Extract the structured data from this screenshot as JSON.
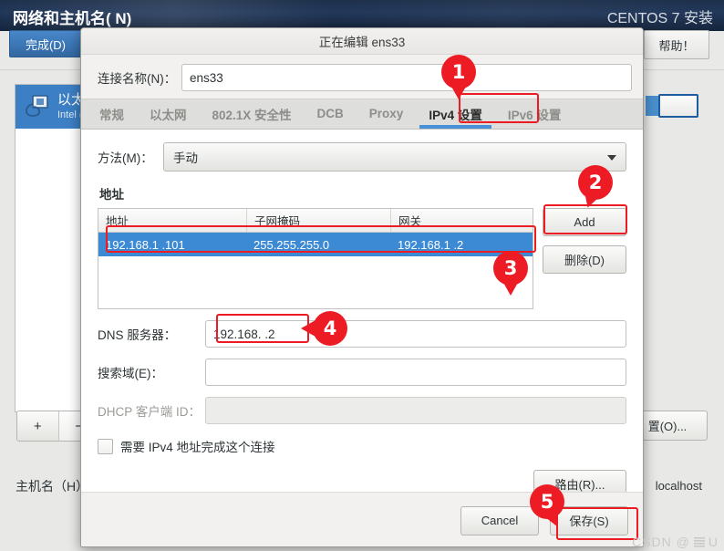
{
  "installer": {
    "page_title": "网络和主机名( N)",
    "brand": "CENTOS 7 安装",
    "done_label": "完成(D)",
    "help_label": "帮助！",
    "device": {
      "name": "以太",
      "sub": "Intel (",
      "icon": "ethernet-icon"
    },
    "list_add": "+",
    "list_remove": "−",
    "config_button": "置(O)...",
    "hostname_label": "主机名（H）",
    "hostname_value": "localhost"
  },
  "dialog": {
    "title": "正在编辑 ens33",
    "connection_name_label": "连接名称(N)：",
    "connection_name_value": "ens33",
    "tabs": [
      {
        "label": "常规",
        "active": false
      },
      {
        "label": "以太网",
        "active": false
      },
      {
        "label": "802.1X 安全性",
        "active": false
      },
      {
        "label": "DCB",
        "active": false
      },
      {
        "label": "Proxy",
        "active": false
      },
      {
        "label": "IPv4 设置",
        "active": true
      },
      {
        "label": "IPv6 设置",
        "active": false
      }
    ],
    "method_label": "方法(M)：",
    "method_value": "手动",
    "addresses_title": "地址",
    "table": {
      "headers": [
        "地址",
        "子网掩码",
        "网关"
      ],
      "rows": [
        {
          "address": "192.168.1  .101",
          "netmask": "255.255.255.0",
          "gateway": "192.168.1  .2",
          "selected": true
        }
      ]
    },
    "add_label": "Add",
    "delete_label": "删除(D)",
    "dns_label": "DNS 服务器：",
    "dns_value": "192.168.     .2",
    "search_label": "搜索域(E)：",
    "search_value": "",
    "dhcp_label": "DHCP 客户端 ID：",
    "dhcp_value": "",
    "require_ipv4_label": "需要 IPv4 地址完成这个连接",
    "routes_label": "路由(R)...",
    "cancel_label": "Cancel",
    "save_label": "保存(S)"
  },
  "annotations": {
    "badges": [
      "1",
      "2",
      "3",
      "4",
      "5"
    ],
    "accent_color": "#ed1c24"
  },
  "watermark": {
    "text": "CSDN @",
    "suffix": "U"
  }
}
